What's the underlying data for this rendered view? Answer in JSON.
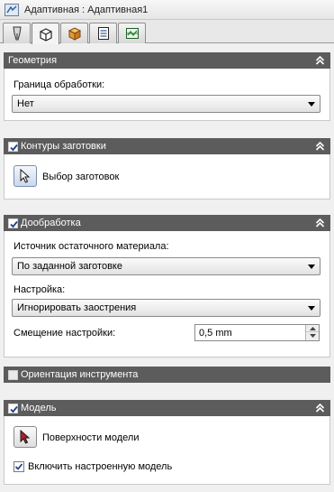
{
  "window": {
    "title": "Адаптивная : Адаптивная1"
  },
  "tabs": [
    {
      "icon": "tool-icon",
      "active": false
    },
    {
      "icon": "cube-outline-icon",
      "active": true
    },
    {
      "icon": "cube-solid-icon",
      "active": false
    },
    {
      "icon": "list-icon",
      "active": false
    },
    {
      "icon": "linking-icon",
      "active": false
    }
  ],
  "geometry": {
    "title": "Геометрия",
    "boundary_label": "Граница обработки:",
    "boundary_value": "Нет"
  },
  "stock_contours": {
    "title": "Контуры заготовки",
    "checked": true,
    "select_label": "Выбор заготовок"
  },
  "rest_machining": {
    "title": "Дообработка",
    "checked": true,
    "source_label": "Источник остаточного материала:",
    "source_value": "По заданной заготовке",
    "adjust_label": "Настройка:",
    "adjust_value": "Игнорировать заострения",
    "offset_label": "Смещение настройки:",
    "offset_value": "0,5 mm"
  },
  "tool_orientation": {
    "title": "Ориентация инструмента",
    "checked": false
  },
  "model": {
    "title": "Модель",
    "checked": true,
    "surfaces_label": "Поверхности модели",
    "include_label": "Включить настроенную модель",
    "include_checked": true
  },
  "colors": {
    "section_header": "#5c5c5c",
    "panel_bg": "#ffffff",
    "window_bg": "#f0f0f0"
  }
}
